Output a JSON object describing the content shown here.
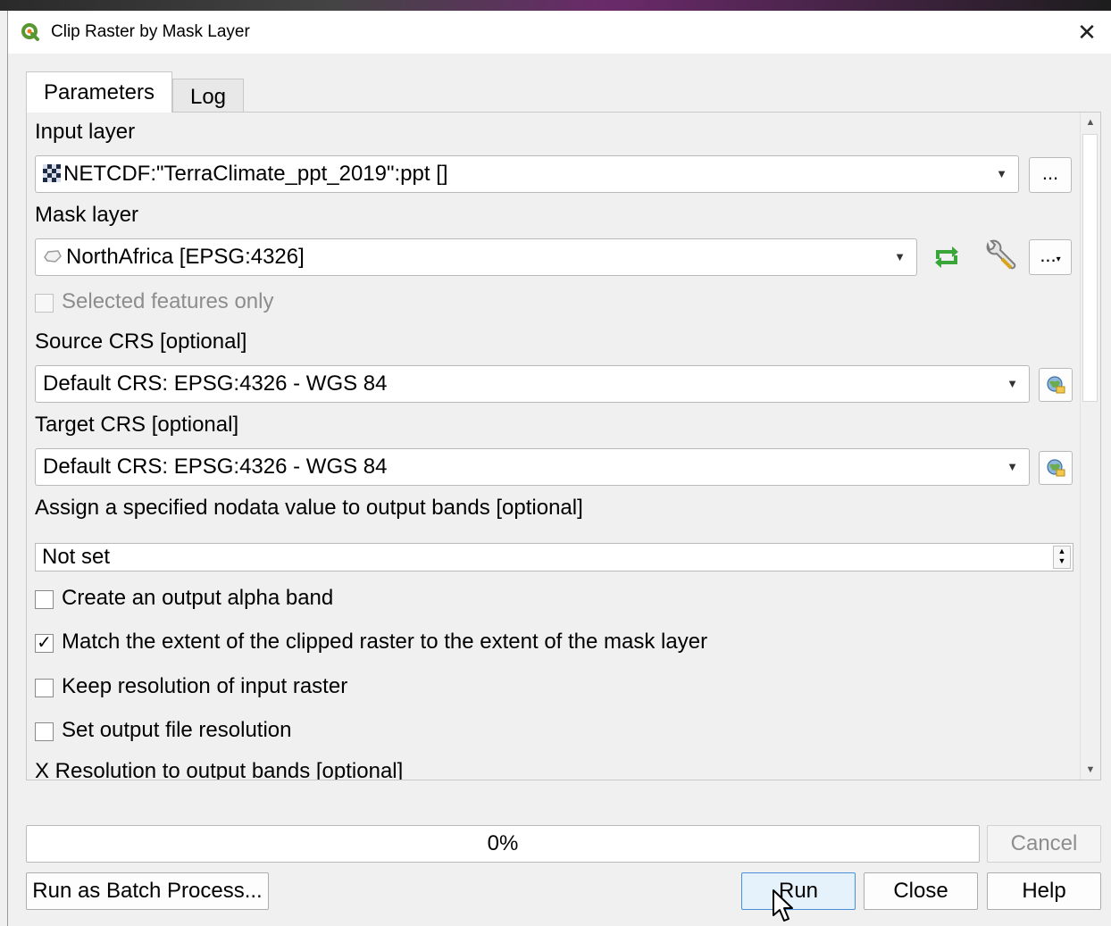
{
  "window": {
    "title": "Clip Raster by Mask Layer",
    "close_glyph": "✕",
    "app_icon": "qgis-logo"
  },
  "tabs": [
    {
      "label": "Parameters",
      "selected": true
    },
    {
      "label": "Log",
      "selected": false
    }
  ],
  "params": {
    "input_layer": {
      "label": "Input layer",
      "value": "NETCDF:\"TerraClimate_ppt_2019\":ppt []",
      "icon": "raster-layer-icon",
      "browse_label": "..."
    },
    "mask_layer": {
      "label": "Mask layer",
      "value": "NorthAfrica [EPSG:4326]",
      "icon": "polygon-layer-icon",
      "browse_label": "..."
    },
    "selected_only": {
      "label": "Selected features only",
      "checked": false,
      "enabled": false
    },
    "source_crs": {
      "label": "Source CRS [optional]",
      "value": "Default CRS: EPSG:4326 - WGS 84"
    },
    "target_crs": {
      "label": "Target CRS [optional]",
      "value": "Default CRS: EPSG:4326 - WGS 84"
    },
    "nodata": {
      "label": "Assign a specified nodata value to output bands [optional]",
      "value": "Not set"
    },
    "alpha_band": {
      "label": "Create an output alpha band",
      "checked": false
    },
    "match_extent": {
      "label": "Match the extent of the clipped raster to the extent of the mask layer",
      "checked": true
    },
    "keep_resolution": {
      "label": "Keep resolution of input raster",
      "checked": false
    },
    "set_resolution": {
      "label": "Set output file resolution",
      "checked": false
    },
    "x_resolution": {
      "label": "X Resolution to output bands [optional]"
    }
  },
  "progress": {
    "text": "0%",
    "value": 0
  },
  "buttons": {
    "cancel": "Cancel",
    "batch": "Run as Batch Process...",
    "run": "Run",
    "close": "Close",
    "help": "Help"
  },
  "colors": {
    "accent": "#4a90d9",
    "iterate_icon": "#3aa63a"
  }
}
